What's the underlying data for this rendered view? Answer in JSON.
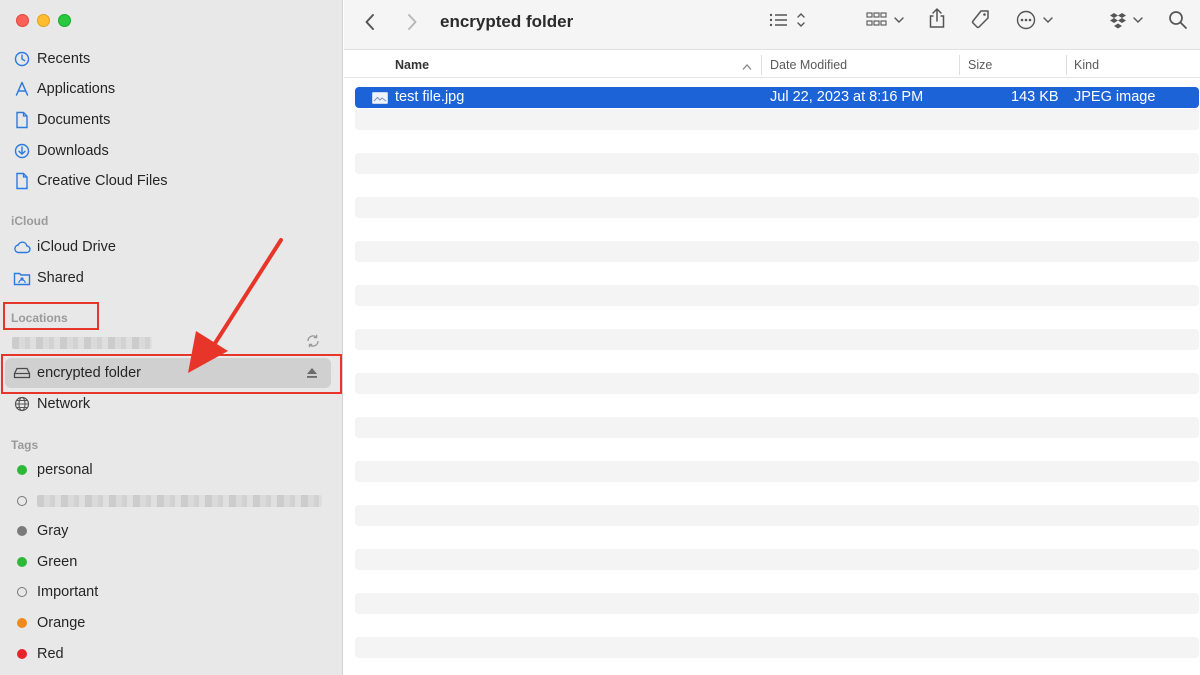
{
  "sidebar": {
    "favorites": [
      {
        "label": "Recents",
        "icon": "clock-icon"
      },
      {
        "label": "Applications",
        "icon": "applications-icon"
      },
      {
        "label": "Documents",
        "icon": "document-icon"
      },
      {
        "label": "Downloads",
        "icon": "download-icon"
      },
      {
        "label": "Creative Cloud Files",
        "icon": "file-icon"
      }
    ],
    "icloud_header": "iCloud",
    "icloud": [
      {
        "label": "iCloud Drive",
        "icon": "cloud-icon"
      },
      {
        "label": "Shared",
        "icon": "shared-folder-icon"
      }
    ],
    "locations_header": "Locations",
    "locations": [
      {
        "label": "encrypted folder",
        "icon": "drive-icon",
        "selected": true
      },
      {
        "label": "Network",
        "icon": "globe-icon"
      }
    ],
    "tags_header": "Tags",
    "tags": [
      {
        "label": "personal",
        "color": "#2db837"
      },
      {
        "label": "Gray",
        "color": "#7a7a7a"
      },
      {
        "label": "Green",
        "color": "#2db837"
      },
      {
        "label": "Important",
        "color": "hollow"
      },
      {
        "label": "Orange",
        "color": "#f08a1c"
      },
      {
        "label": "Red",
        "color": "#e8242b"
      }
    ]
  },
  "toolbar": {
    "title": "encrypted folder"
  },
  "columns": {
    "name": "Name",
    "date_modified": "Date Modified",
    "size": "Size",
    "kind": "Kind"
  },
  "files": [
    {
      "name": "test file.jpg",
      "date_modified": "Jul 22, 2023 at 8:16 PM",
      "size": "143 KB",
      "kind": "JPEG image",
      "selected": true
    }
  ],
  "colors": {
    "selection": "#1c63d7",
    "annotation": "#e8352a"
  }
}
